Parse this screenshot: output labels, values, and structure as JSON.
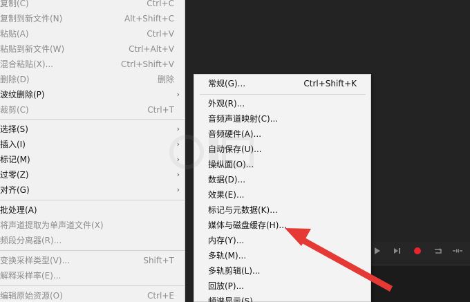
{
  "edit_menu": {
    "items": [
      {
        "label": "复制(C)",
        "shortcut": "Ctrl+C",
        "disabled": true
      },
      {
        "label": "复制到新文件(N)",
        "shortcut": "Alt+Shift+C",
        "disabled": true
      },
      {
        "label": "粘贴(A)",
        "shortcut": "Ctrl+V",
        "disabled": true
      },
      {
        "label": "粘贴到新文件(W)",
        "shortcut": "Ctrl+Alt+V",
        "disabled": true
      },
      {
        "label": "混合粘贴(X)...",
        "shortcut": "Ctrl+Shift+V",
        "disabled": true
      },
      {
        "label": "删除(D)",
        "shortcut": "删除",
        "disabled": true
      },
      {
        "label": "波纹删除(P)",
        "shortcut": "",
        "disabled": false
      },
      {
        "label": "裁剪(C)",
        "shortcut": "Ctrl+T",
        "disabled": true
      },
      {
        "label": "选择(S)",
        "shortcut": "",
        "disabled": false
      },
      {
        "label": "插入(I)",
        "shortcut": "",
        "disabled": false
      },
      {
        "label": "标记(M)",
        "shortcut": "",
        "disabled": false
      },
      {
        "label": "过零(Z)",
        "shortcut": "",
        "disabled": false
      },
      {
        "label": "对齐(G)",
        "shortcut": "",
        "disabled": false
      },
      {
        "label": "批处理(A)",
        "shortcut": "",
        "disabled": false
      },
      {
        "label": "将声道提取为单声道文件(X)",
        "shortcut": "",
        "disabled": true
      },
      {
        "label": "频段分离器(R)...",
        "shortcut": "",
        "disabled": true
      },
      {
        "label": "变换采样类型(V)...",
        "shortcut": "Shift+T",
        "disabled": true
      },
      {
        "label": "解释采样率(E)...",
        "shortcut": "",
        "disabled": true
      },
      {
        "label": "编辑原始资源(O)",
        "shortcut": "Ctrl+E",
        "disabled": true
      }
    ]
  },
  "preferences_menu": {
    "items": [
      {
        "label": "常规(G)...",
        "shortcut": "Ctrl+Shift+K"
      },
      {
        "label": "外观(R)...",
        "shortcut": ""
      },
      {
        "label": "音频声道映射(C)...",
        "shortcut": ""
      },
      {
        "label": "音频硬件(A)...",
        "shortcut": ""
      },
      {
        "label": "自动保存(U)...",
        "shortcut": ""
      },
      {
        "label": "操纵面(O)...",
        "shortcut": ""
      },
      {
        "label": "数据(D)...",
        "shortcut": ""
      },
      {
        "label": "效果(E)...",
        "shortcut": ""
      },
      {
        "label": "标记与元数据(K)...",
        "shortcut": ""
      },
      {
        "label": "媒体与磁盘缓存(H)...",
        "shortcut": ""
      },
      {
        "label": "内存(Y)...",
        "shortcut": ""
      },
      {
        "label": "多轨(M)...",
        "shortcut": ""
      },
      {
        "label": "多轨剪辑(L)...",
        "shortcut": ""
      },
      {
        "label": "回放(P)...",
        "shortcut": ""
      },
      {
        "label": "频谱显示(S)...",
        "shortcut": ""
      }
    ]
  },
  "transport": {
    "icons": [
      "skip-forward-icon",
      "record-icon",
      "loop-icon",
      "skip-selection-icon"
    ],
    "record_color": "#e5262c"
  },
  "annotation": {
    "arrow_color": "#e53935"
  }
}
